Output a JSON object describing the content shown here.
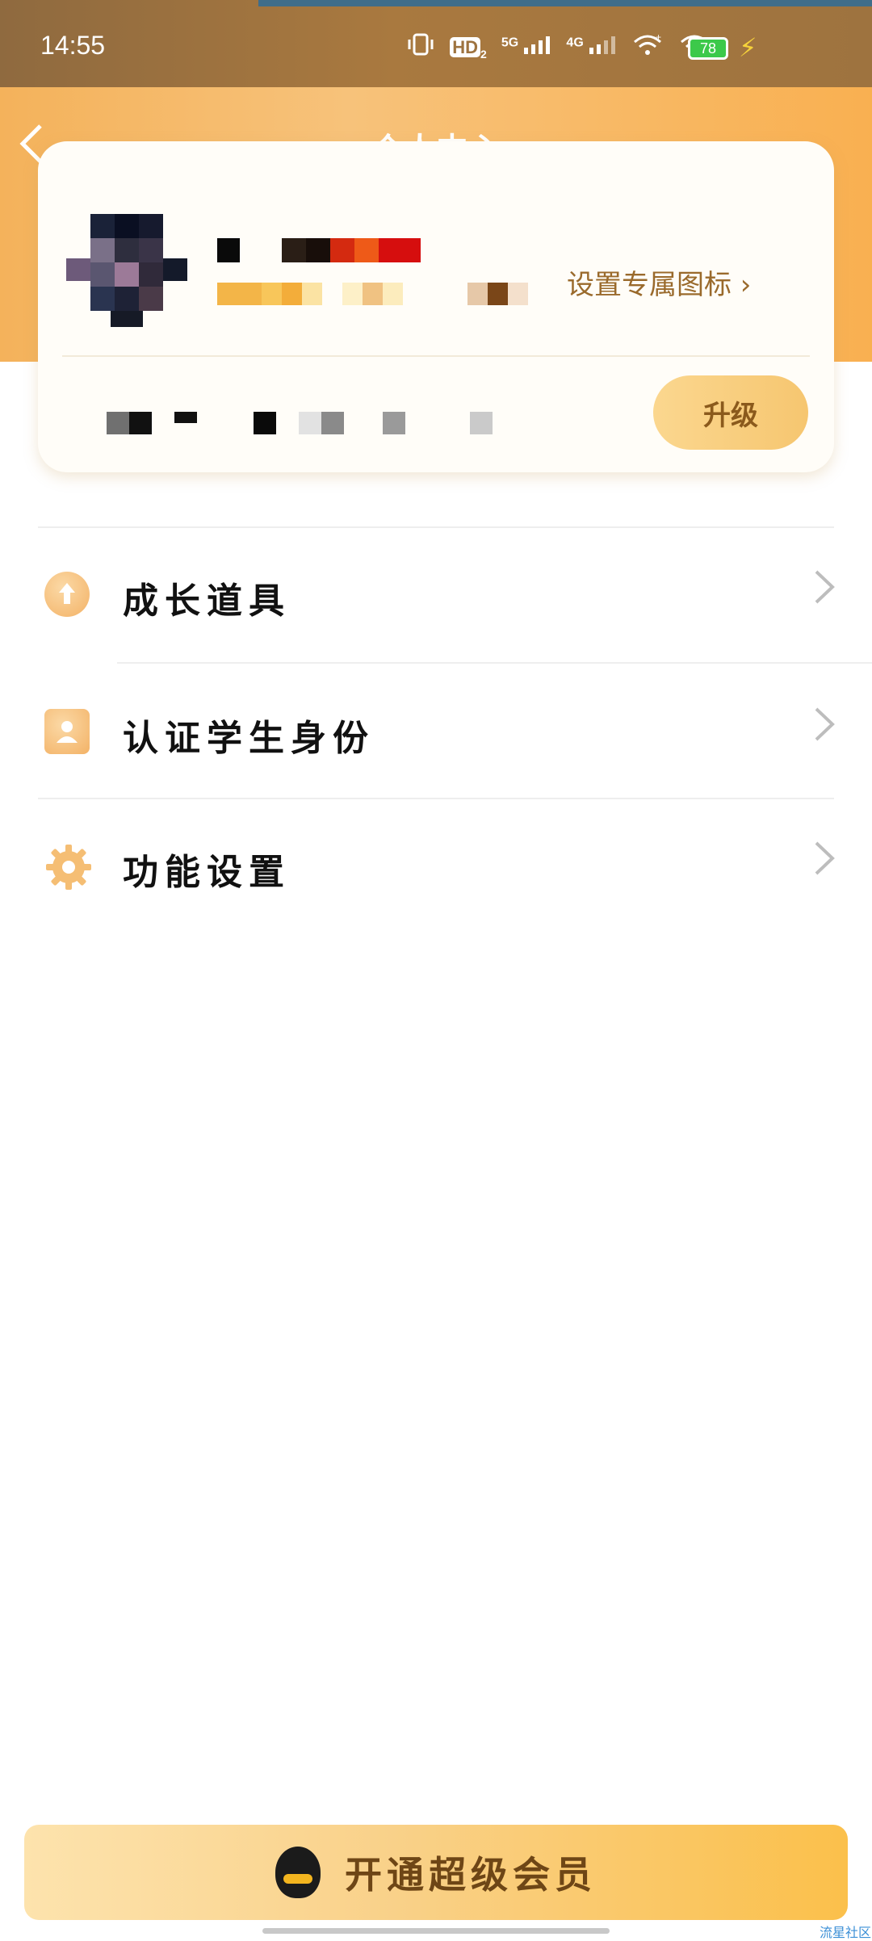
{
  "status_bar": {
    "time": "14:55",
    "icons": [
      "vibrate-icon",
      "hd-icon",
      "5g-signal-icon",
      "4g-signal-icon",
      "wifi-plus-icon",
      "wifi-icon"
    ],
    "hd_label": "HD",
    "hd_sub": "2",
    "net1_label": "5G",
    "net2_label": "4G",
    "battery_level": "78",
    "charging": true
  },
  "header": {
    "back_icon": "chevron-left-icon",
    "title": "个人中心"
  },
  "profile_card": {
    "set_icon_link": "设置专属图标",
    "upgrade_button": "升级"
  },
  "menu": {
    "items": [
      {
        "label": "成长道具",
        "icon": "arrow-up-circle-icon"
      },
      {
        "label": "认证学生身份",
        "icon": "id-card-icon"
      },
      {
        "label": "功能设置",
        "icon": "gear-icon"
      }
    ]
  },
  "vip_bar": {
    "label": "开通超级会员",
    "icon": "qq-penguin-icon"
  },
  "watermark": "流星社区",
  "colors": {
    "status_bar": "#9e733f",
    "header": "#f7c27a",
    "accent_text": "#9a6a2c",
    "upgrade_button": "#f6c670",
    "vip_bar": "#fbc04b"
  }
}
